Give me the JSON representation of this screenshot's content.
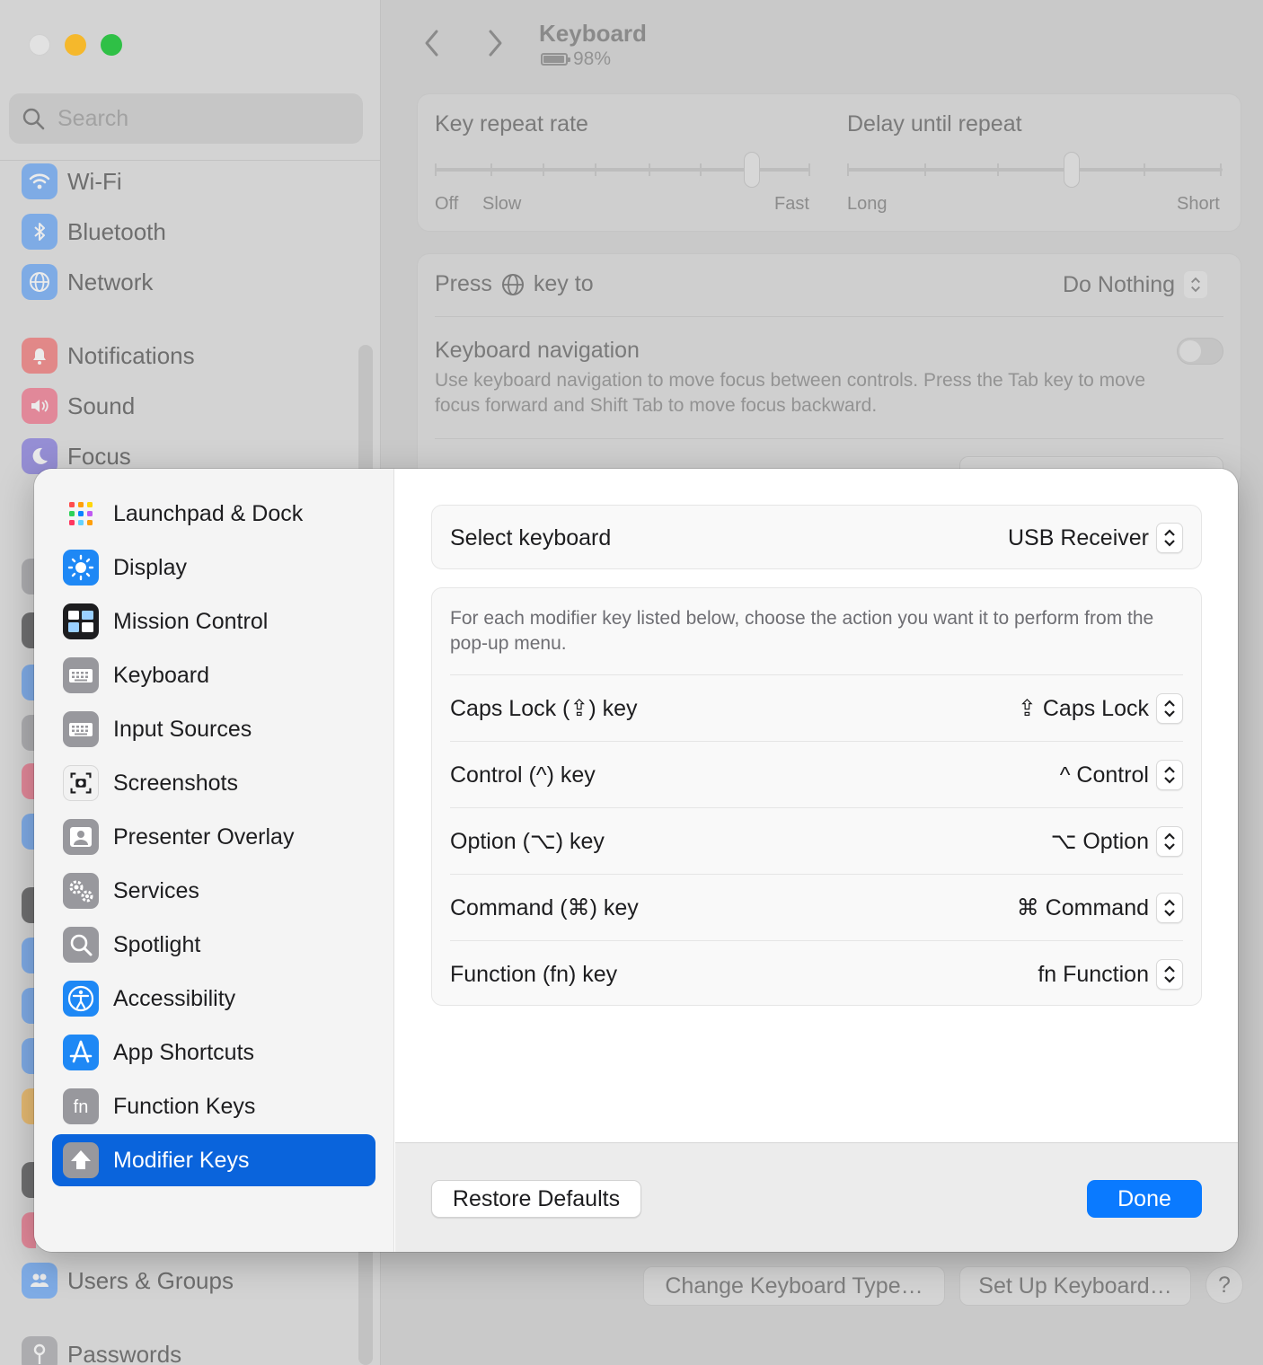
{
  "window": {
    "title": "Keyboard",
    "battery_text": "98%"
  },
  "search": {
    "placeholder": "Search"
  },
  "sidebar": {
    "items": [
      {
        "label": "Wi-Fi",
        "icon": "wifi-icon",
        "color": "#3a8bf5"
      },
      {
        "label": "Bluetooth",
        "icon": "bluetooth-icon",
        "color": "#3a8bf5"
      },
      {
        "label": "Network",
        "icon": "network-globe-icon",
        "color": "#3a8bf5"
      },
      {
        "label": "Notifications",
        "icon": "bell-icon",
        "color": "#ee4b4b"
      },
      {
        "label": "Sound",
        "icon": "speaker-icon",
        "color": "#ee4b6a"
      },
      {
        "label": "Focus",
        "icon": "moon-icon",
        "color": "#6457d6"
      },
      {
        "label": "Users & Groups",
        "icon": "users-icon",
        "color": "#3a8bf5"
      },
      {
        "label": "Passwords",
        "icon": "key-icon",
        "color": "#8e8e93"
      }
    ]
  },
  "keyboard_pane": {
    "key_repeat": {
      "label": "Key repeat rate",
      "left": "Off",
      "mid": "Slow",
      "right": "Fast"
    },
    "delay": {
      "label": "Delay until repeat",
      "left": "Long",
      "right": "Short"
    },
    "press_key": {
      "label_before": "Press",
      "label_after": "key to",
      "value": "Do Nothing"
    },
    "nav": {
      "label": "Keyboard navigation",
      "description": "Use keyboard navigation to move focus between controls. Press the Tab key to move focus forward and Shift Tab to move focus backward."
    },
    "buttons": {
      "change_type": "Change Keyboard Type…",
      "setup": "Set Up Keyboard…",
      "help": "?"
    }
  },
  "sheet": {
    "sidebar": [
      {
        "label": "Launchpad & Dock",
        "icon": "launchpad-icon"
      },
      {
        "label": "Display",
        "icon": "brightness-icon"
      },
      {
        "label": "Mission Control",
        "icon": "mission-control-icon"
      },
      {
        "label": "Keyboard",
        "icon": "keyboard-icon"
      },
      {
        "label": "Input Sources",
        "icon": "input-sources-icon"
      },
      {
        "label": "Screenshots",
        "icon": "screenshot-icon"
      },
      {
        "label": "Presenter Overlay",
        "icon": "presenter-overlay-icon"
      },
      {
        "label": "Services",
        "icon": "gears-icon"
      },
      {
        "label": "Spotlight",
        "icon": "spotlight-icon"
      },
      {
        "label": "Accessibility",
        "icon": "accessibility-icon"
      },
      {
        "label": "App Shortcuts",
        "icon": "app-store-icon"
      },
      {
        "label": "Function Keys",
        "icon": "fn-key-icon"
      },
      {
        "label": "Modifier Keys",
        "icon": "modifier-key-icon",
        "selected": true
      }
    ],
    "select_keyboard": {
      "label": "Select keyboard",
      "value": "USB Receiver"
    },
    "description": "For each modifier key listed below, choose the action you want it to perform from the pop-up menu.",
    "modifiers": [
      {
        "label": "Caps Lock (⇪) key",
        "value": "⇪ Caps Lock"
      },
      {
        "label": "Control (^) key",
        "value": "^ Control"
      },
      {
        "label": "Option (⌥) key",
        "value": "⌥ Option"
      },
      {
        "label": "Command (⌘) key",
        "value": "⌘ Command"
      },
      {
        "label": "Function (fn) key",
        "value": "fn Function"
      }
    ],
    "buttons": {
      "restore": "Restore Defaults",
      "done": "Done"
    },
    "accent": "#0a7aff",
    "selection_color": "#0a64dc"
  }
}
